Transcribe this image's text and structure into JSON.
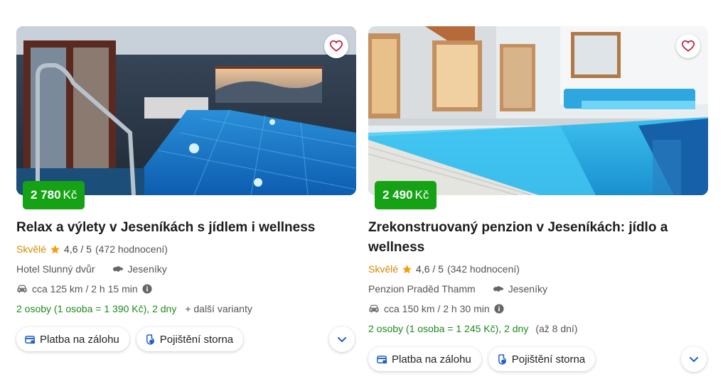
{
  "accent": "#15a215",
  "cards": [
    {
      "price_amount": "2 780",
      "price_currency": "Kč",
      "title": "Relax a výlety v Jeseníkách s jídlem i wellness",
      "rating_word": "Skvělé",
      "rating_score": "4,6 / 5",
      "rating_count": "(472 hodnocení)",
      "hotel": "Hotel Slunný dvůr",
      "region": "Jeseníky",
      "distance": "cca 125 km / 2 h 15 min",
      "persons": "2 osoby (1 osoba = 1 390 Kč), 2 dny",
      "variants": "+ další varianty",
      "chip_payment": "Platba na zálohu",
      "chip_insurance": "Pojištění storna"
    },
    {
      "price_amount": "2 490",
      "price_currency": "Kč",
      "title": "Zrekonstruovaný penzion v Jeseníkách: jídlo a wellness",
      "rating_word": "Skvělé",
      "rating_score": "4,6 / 5",
      "rating_count": "(342 hodnocení)",
      "hotel": "Penzion Praděd Thamm",
      "region": "Jeseníky",
      "distance": "cca 150 km / 2 h 30 min",
      "persons": "2 osoby (1 osoba = 1 245 Kč), 2 dny",
      "duration_note": "(až 8 dní)",
      "chip_payment": "Platba na zálohu",
      "chip_insurance": "Pojištění storna"
    }
  ]
}
